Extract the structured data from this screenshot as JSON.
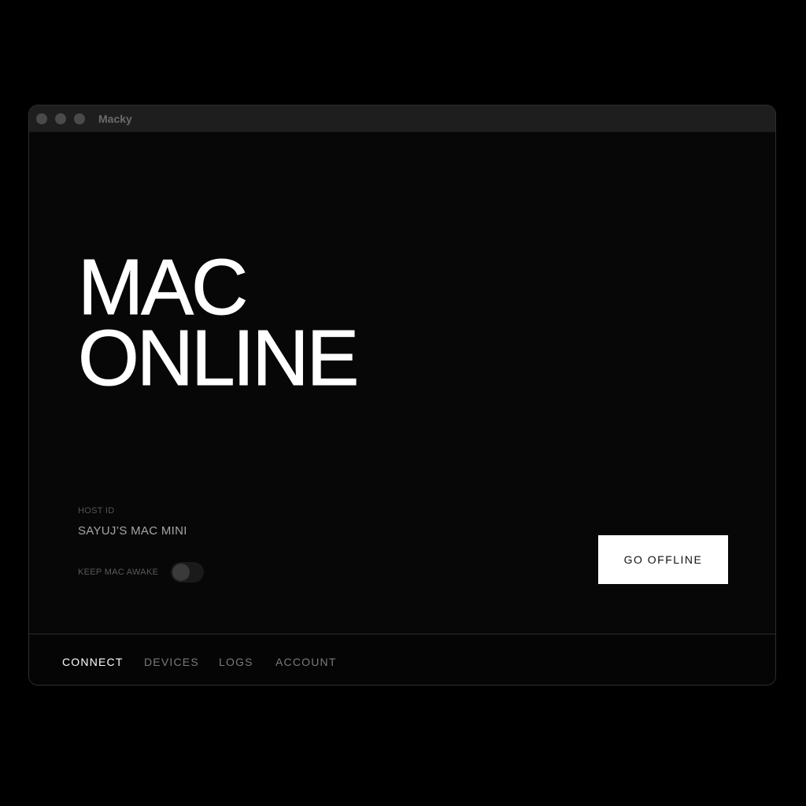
{
  "window": {
    "title": "Macky"
  },
  "main": {
    "headline_line1": "MAC",
    "headline_line2": "ONLINE",
    "host_id_label": "HOST ID",
    "host_id_value": "SAYUJ’S MAC MINI",
    "keep_awake_label": "KEEP MAC AWAKE",
    "keep_awake_enabled": false,
    "go_offline_label": "GO OFFLINE"
  },
  "nav": {
    "active": "CONNECT",
    "tabs": [
      "CONNECT",
      "DEVICES",
      "LOGS",
      "ACCOUNT"
    ]
  }
}
